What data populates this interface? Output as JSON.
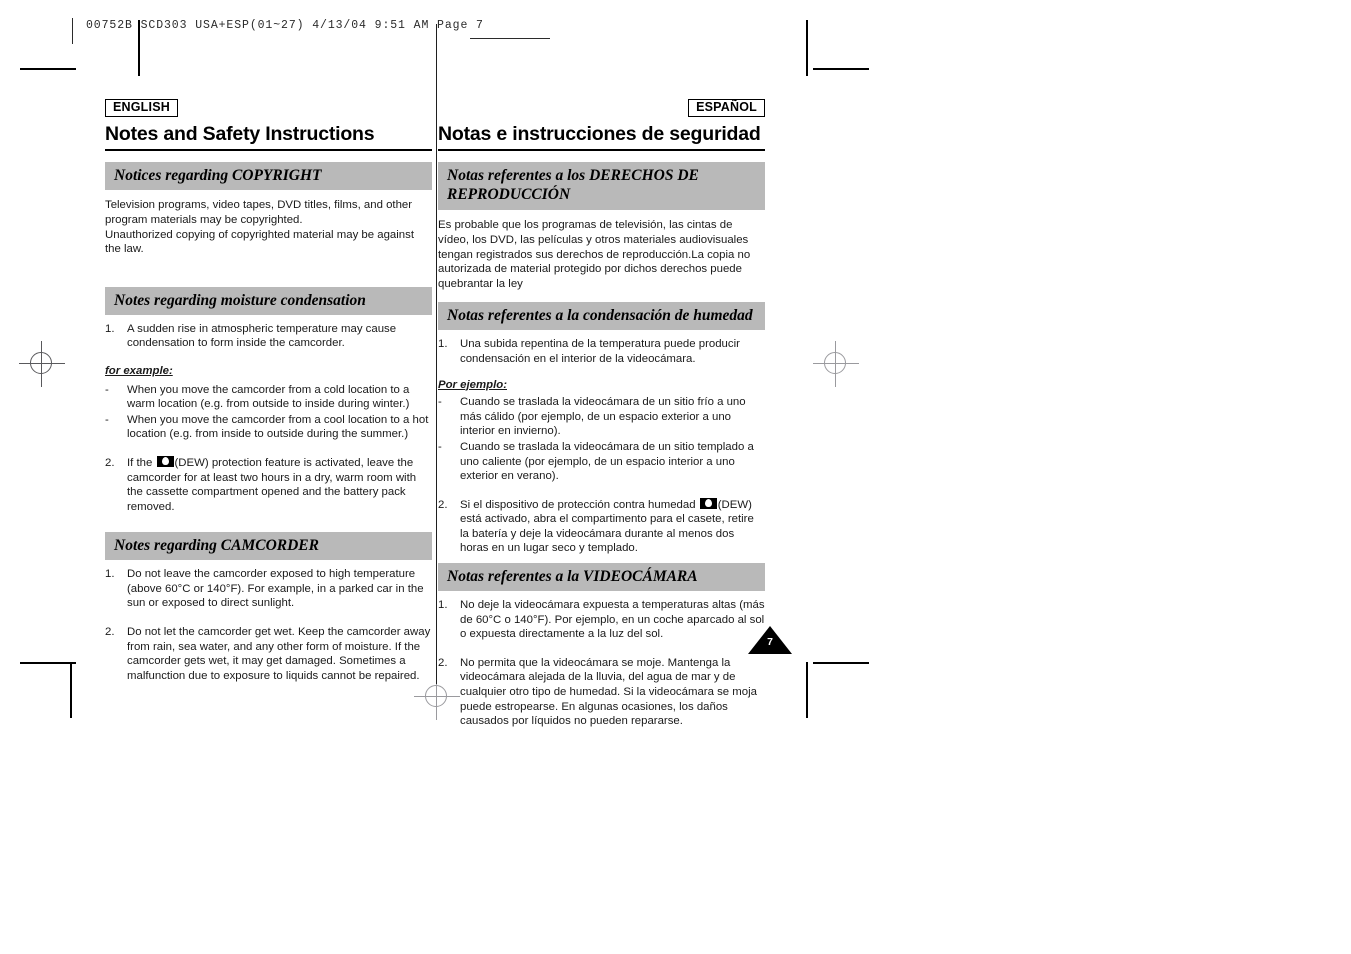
{
  "running_header": {
    "text": "00752B SCD303 USA+ESP(01~27)   4/13/04 9:51 AM   Page 7"
  },
  "page_number": "7",
  "english": {
    "language_badge": "ENGLISH",
    "title": "Notes and Safety Instructions",
    "sections": [
      {
        "heading": "Notices regarding COPYRIGHT",
        "paragraphs": [
          "Television programs, video tapes, DVD titles, films, and other program materials may be copyrighted.",
          "Unauthorized copying of copyrighted material may be against the law."
        ]
      },
      {
        "heading": "Notes regarding moisture condensation",
        "item1_num": "1.",
        "item1_text": "A sudden rise in atmospheric temperature may cause condensation to form inside the camcorder.",
        "for_example_label": "for example:",
        "bullet_marker": "-",
        "bullets": [
          "When you move the camcorder from a cold location to a warm location (e.g. from outside to inside during winter.)",
          "When you move the camcorder from a cool location to a hot location (e.g. from inside to outside during the summer.)"
        ],
        "item2_num": "2.",
        "item2_pre": "If the ",
        "item2_post": "(DEW) protection feature is activated, leave the camcorder for at least two hours in a dry, warm room with the cassette compartment opened and the battery pack removed."
      },
      {
        "heading": "Notes regarding CAMCORDER",
        "item1_num": "1.",
        "item1_text": "Do not leave the camcorder exposed to high temperature (above 60°C or 140°F). For example, in a parked car in the sun or exposed to direct sunlight.",
        "item2_num": "2.",
        "item2_text": "Do not let the camcorder get wet. Keep the camcorder away from rain, sea water, and any other form of moisture. If the camcorder gets wet, it may get damaged. Sometimes a malfunction due to exposure to liquids cannot be repaired."
      }
    ]
  },
  "spanish": {
    "language_badge": "ESPAÑOL",
    "title": "Notas e instrucciones de seguridad",
    "sections": [
      {
        "heading": "Notas referentes a los DERECHOS DE REPRODUCCIÓN",
        "paragraphs": [
          "Es probable que los programas de televisión, las cintas de vídeo, los DVD, las películas y otros materiales audiovisuales tengan registrados sus derechos de reproducción.La copia no autorizada de material protegido por dichos derechos puede quebrantar la ley"
        ]
      },
      {
        "heading": "Notas referentes a la condensación de humedad",
        "item1_num": "1.",
        "item1_text": "Una subida repentina de la temperatura puede producir condensación en el interior de la videocámara.",
        "for_example_label": "Por ejemplo:",
        "bullet_marker": "-",
        "bullets": [
          "Cuando se traslada la videocámara de un sitio frío a uno más cálido (por ejemplo, de un espacio exterior a uno interior en invierno).",
          "Cuando se traslada la videocámara de un sitio templado a uno caliente (por ejemplo, de un espacio interior a uno exterior en verano)."
        ],
        "item2_num": "2.",
        "item2_pre": "Si el dispositivo de protección contra humedad ",
        "item2_post": "(DEW) está activado, abra el compartimento para el casete, retire la batería y deje la videocámara durante al menos dos horas en un lugar seco y templado."
      },
      {
        "heading": "Notas referentes a la VIDEOCÁMARA",
        "item1_num": "1.",
        "item1_text": "No deje la videocámara expuesta a temperaturas altas (más de 60°C o 140°F). Por ejemplo, en un coche aparcado al sol o expuesta directamente a la luz del sol.",
        "item2_num": "2.",
        "item2_text": "No permita que la videocámara se moje. Mantenga la videocámara alejada de la lluvia, del agua de mar y de cualquier otro tipo de humedad. Si la videocámara se moja puede estropearse. En algunas ocasiones, los daños causados por líquidos no pueden repararse."
      }
    ]
  }
}
